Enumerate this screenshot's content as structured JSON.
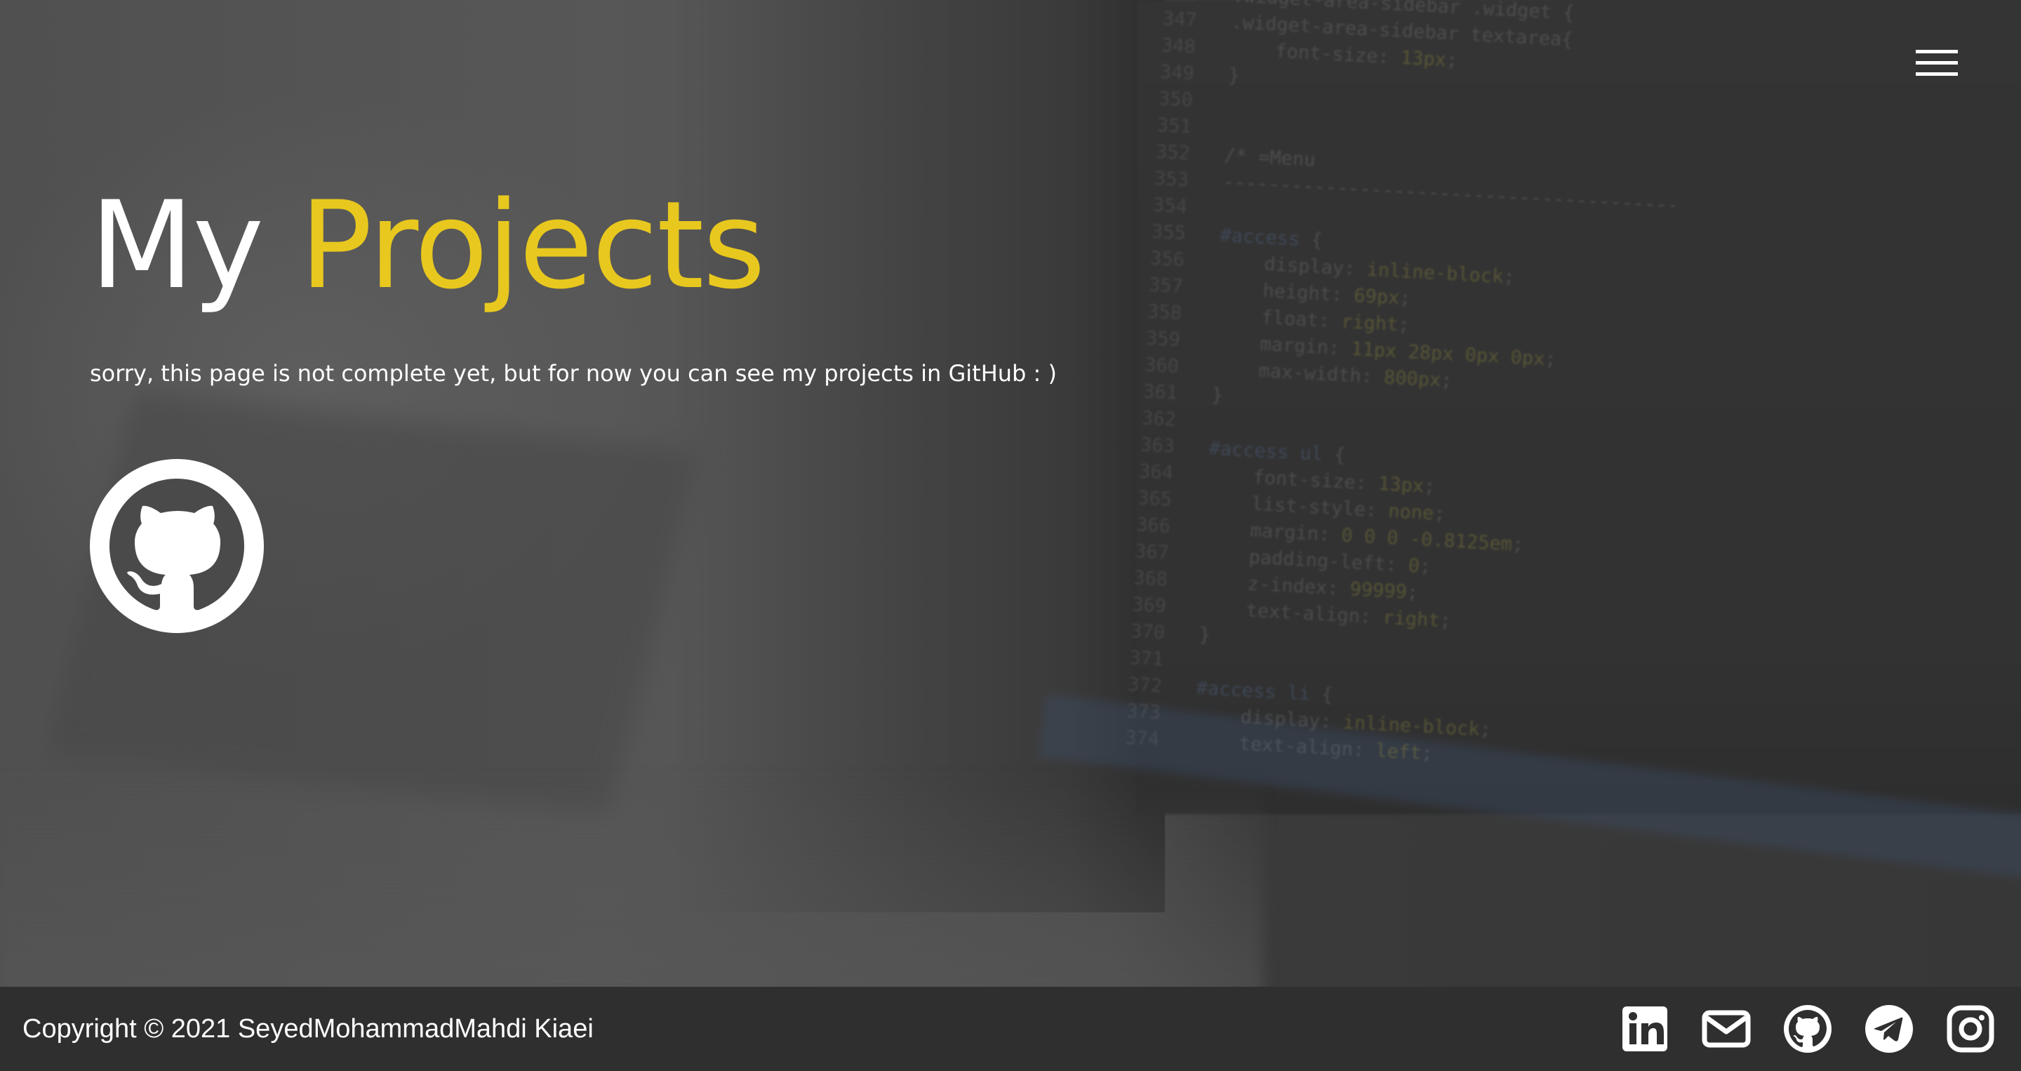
{
  "header": {
    "menu_icon": "hamburger-menu-icon"
  },
  "main": {
    "title_part1": "My",
    "title_part2": "Projects",
    "accent_color": "#e8c81e",
    "message": "sorry, this page is not complete yet, but for now you can see my projects in GitHub : )",
    "github_icon": "github-icon"
  },
  "footer": {
    "copyright": "Copyright © 2021 SeyedMohammadMahdi Kiaei",
    "social_icons": [
      "linkedin-icon",
      "email-icon",
      "github-icon",
      "telegram-icon",
      "instagram-icon"
    ]
  }
}
